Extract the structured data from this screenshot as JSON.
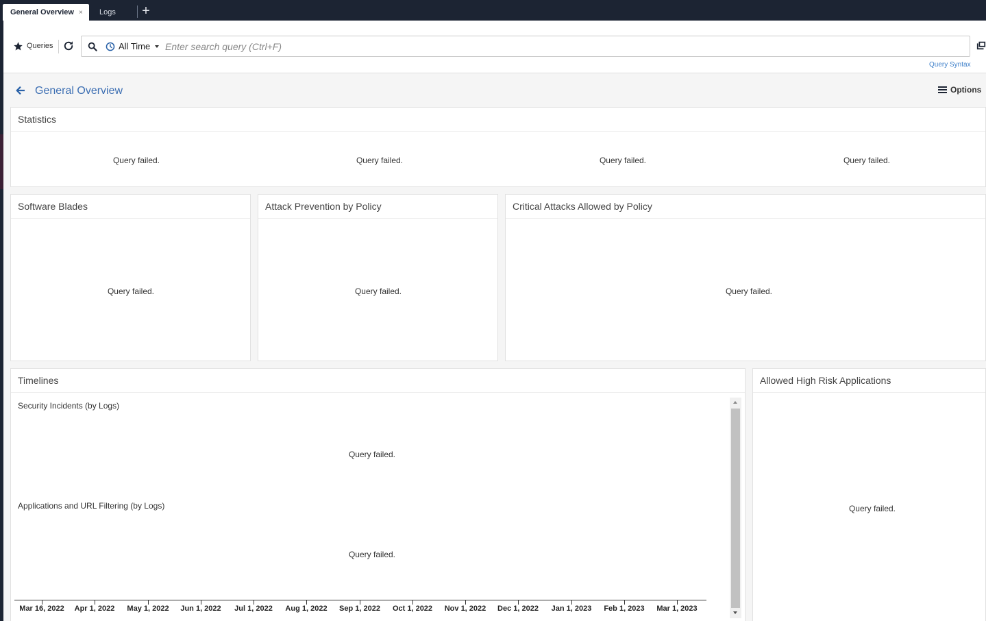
{
  "tabs": {
    "active": "General Overview",
    "close": "×",
    "inactive": "Logs",
    "add": "+"
  },
  "toolbar": {
    "queries_label": "Queries",
    "time_range": "All Time",
    "search_placeholder": "Enter search query (Ctrl+F)",
    "query_syntax_link": "Query Syntax"
  },
  "page": {
    "title": "General Overview",
    "options_label": "Options"
  },
  "statistics": {
    "title": "Statistics",
    "cells": [
      "Query failed.",
      "Query failed.",
      "Query failed.",
      "Query failed."
    ]
  },
  "software_blades": {
    "title": "Software Blades",
    "status": "Query failed."
  },
  "attack_prevention": {
    "title": "Attack Prevention by Policy",
    "status": "Query failed."
  },
  "critical_attacks": {
    "title": "Critical Attacks Allowed by Policy",
    "status": "Query failed."
  },
  "timelines": {
    "title": "Timelines",
    "security_incidents": {
      "title": "Security Incidents (by Logs)",
      "status": "Query failed."
    },
    "app_url_filtering": {
      "title": "Applications and URL Filtering (by Logs)",
      "status": "Query failed."
    },
    "axis_ticks": [
      "Mar 16, 2022",
      "Apr 1, 2022",
      "May 1, 2022",
      "Jun 1, 2022",
      "Jul 1, 2022",
      "Aug 1, 2022",
      "Sep 1, 2022",
      "Oct 1, 2022",
      "Nov 1, 2022",
      "Dec 1, 2022",
      "Jan 1, 2023",
      "Feb 1, 2023",
      "Mar 1, 2023"
    ]
  },
  "high_risk_apps": {
    "title": "Allowed High Risk Applications",
    "status": "Query failed."
  },
  "colors": {
    "tabbar_bg": "#1c2433",
    "link_blue": "#3d6fb3",
    "page_bg": "#f5f5f5"
  }
}
